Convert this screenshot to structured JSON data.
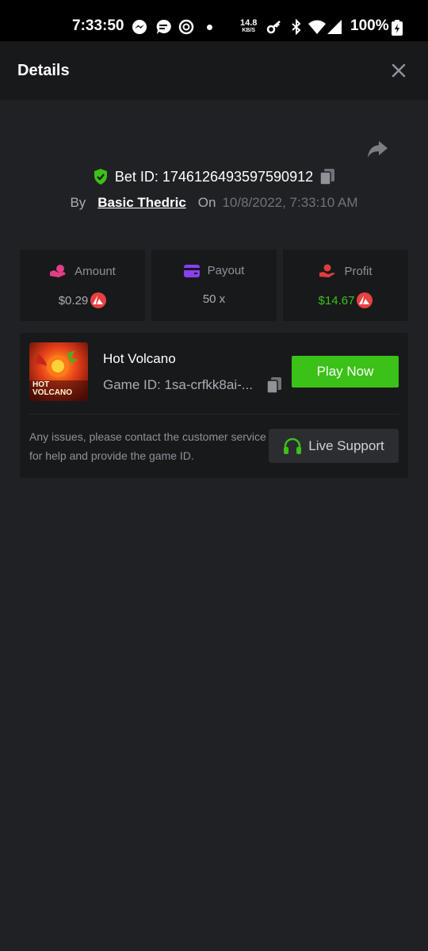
{
  "status_bar": {
    "time": "7:33:50",
    "net_speed_value": "14.8",
    "net_speed_unit": "KB/S",
    "battery": "100%",
    "icons": [
      "messenger-icon",
      "chat-icon",
      "sync-icon",
      "notification-dot",
      "key-icon",
      "bluetooth-icon",
      "wifi-icon",
      "signal-icon",
      "battery-icon"
    ]
  },
  "header": {
    "title": "Details",
    "close_icon": "close-icon"
  },
  "bet": {
    "id_label": "Bet ID: 1746126493597590912",
    "by_label": "By",
    "user": "Basic Thedric",
    "on_label": "On",
    "date": "10/8/2022, 7:33:10 AM"
  },
  "stats": [
    {
      "label": "Amount",
      "value": "$0.29",
      "icon": "amount-icon",
      "color": "#e23f86",
      "value_color": "#a9adb3",
      "has_coin": true
    },
    {
      "label": "Payout",
      "value": "50 x",
      "icon": "wallet-icon",
      "color": "#8a3ff0",
      "value_color": "#a9adb3",
      "has_coin": false
    },
    {
      "label": "Profit",
      "value": "$14.67",
      "icon": "profit-hand-icon",
      "color": "#e03c3c",
      "value_color": "#3bc117",
      "has_coin": true
    }
  ],
  "game": {
    "name": "Hot Volcano",
    "id_label": "Game ID: 1sa-crfkk8ai-...",
    "thumb_text_1": "HOT",
    "thumb_text_2": "VOLCANO",
    "play_label": "Play Now",
    "issues_text": "Any issues, please contact the customer service for help and provide the game ID.",
    "support_label": "Live Support"
  },
  "colors": {
    "background": "#202124",
    "panel": "#18191b",
    "accent_green": "#3bc117",
    "avax_red": "#e84142"
  }
}
